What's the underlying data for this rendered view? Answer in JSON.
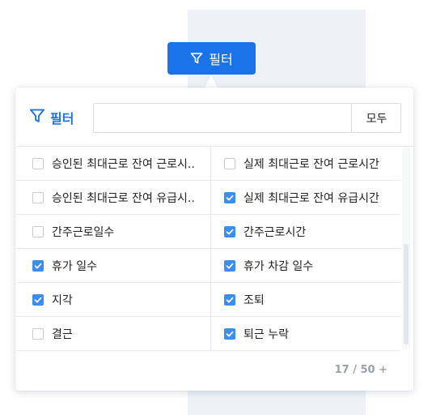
{
  "trigger": {
    "label": "필터",
    "icon": "filter-icon"
  },
  "popover": {
    "title": "필터",
    "title_icon": "filter-icon",
    "search": {
      "value": "",
      "placeholder": ""
    },
    "all_button": "모두",
    "items": [
      {
        "left": {
          "label": "승인된 최대근로 잔여 근로시..",
          "checked": false
        },
        "right": {
          "label": "실제 최대근로 잔여 근로시간",
          "checked": false
        }
      },
      {
        "left": {
          "label": "승인된 최대근로 잔여 유급시..",
          "checked": false
        },
        "right": {
          "label": "실제 최대근로 잔여 유급시간",
          "checked": true
        }
      },
      {
        "left": {
          "label": "간주근로일수",
          "checked": false
        },
        "right": {
          "label": "간주근로시간",
          "checked": true
        }
      },
      {
        "left": {
          "label": "휴가 일수",
          "checked": true
        },
        "right": {
          "label": "휴가 차감 일수",
          "checked": true
        }
      },
      {
        "left": {
          "label": "지각",
          "checked": true
        },
        "right": {
          "label": "조퇴",
          "checked": true
        }
      },
      {
        "left": {
          "label": "결근",
          "checked": false
        },
        "right": {
          "label": "퇴근 누락",
          "checked": true
        }
      }
    ],
    "count_text": "17 / 50 +"
  },
  "colors": {
    "accent": "#1a73e8",
    "checkbox_on": "#3b8ef0",
    "border": "#e6e8ec",
    "muted": "#9aa0a8"
  }
}
